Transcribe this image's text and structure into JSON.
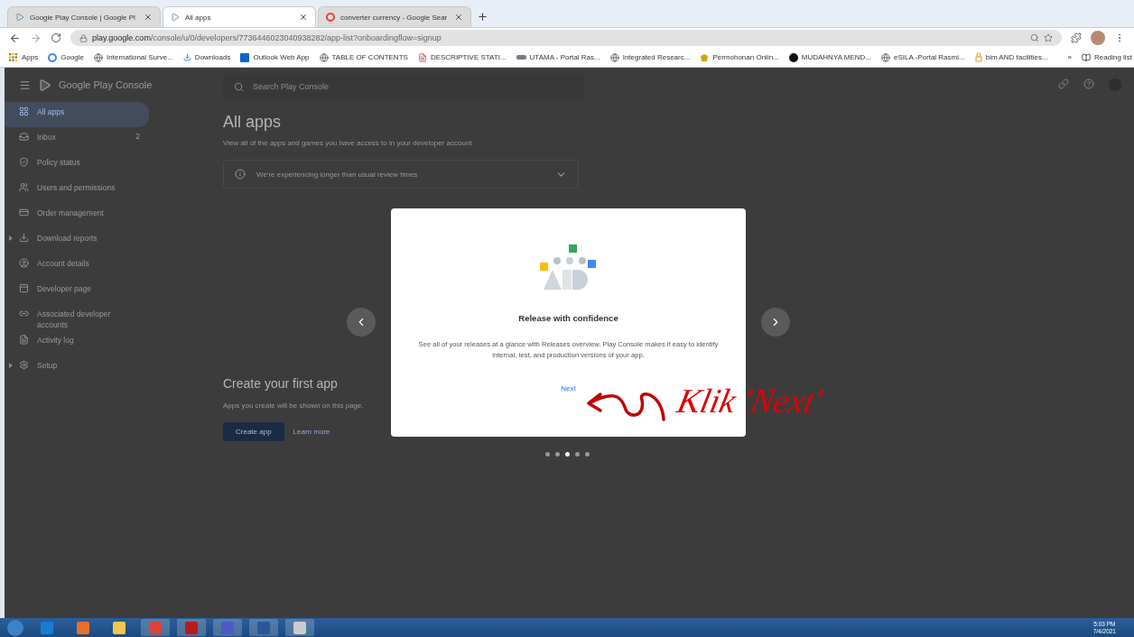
{
  "browser": {
    "tabs": [
      {
        "title": "Google Play Console | Google Pl",
        "selected": false
      },
      {
        "title": "All apps",
        "selected": true
      },
      {
        "title": "converter currency - Google Sear",
        "selected": false
      }
    ],
    "url_host": "play.google.com",
    "url_path": "/console/u/0/developers/7736446023040938282/app-list?onboardingflow=signup",
    "bookmarks": [
      {
        "label": "Apps"
      },
      {
        "label": "Google"
      },
      {
        "label": "International Surve..."
      },
      {
        "label": "Downloads"
      },
      {
        "label": "Outlook Web App"
      },
      {
        "label": "TABLE OF CONTENTS"
      },
      {
        "label": "DESCRIPTIVE STATI..."
      },
      {
        "label": "UTAMA - Portal Ras..."
      },
      {
        "label": "Integrated Researc..."
      },
      {
        "label": "Permohonan Onlin..."
      },
      {
        "label": "MUDAHNYA MEND..."
      },
      {
        "label": "eSILA -Portal Rasmi..."
      },
      {
        "label": "bim AND facilities..."
      }
    ],
    "more": "»",
    "reading_list": "Reading list"
  },
  "console": {
    "brand": "Google Play Console",
    "search": {
      "placeholder": "Search Play Console"
    },
    "nav": [
      {
        "label": "All apps",
        "selected": true,
        "expandable": false
      },
      {
        "label": "Inbox",
        "selected": false,
        "expandable": false,
        "count": "2"
      },
      {
        "label": "Policy status",
        "selected": false,
        "expandable": false
      },
      {
        "label": "Users and permissions",
        "selected": false,
        "expandable": false
      },
      {
        "label": "Order management",
        "selected": false,
        "expandable": false
      },
      {
        "label": "Download reports",
        "selected": false,
        "expandable": true
      },
      {
        "label": "Account details",
        "selected": false,
        "expandable": false
      },
      {
        "label": "Developer page",
        "selected": false,
        "expandable": false
      },
      {
        "label": "Associated developer accounts",
        "selected": false,
        "expandable": false
      },
      {
        "label": "Activity log",
        "selected": false,
        "expandable": false
      },
      {
        "label": "Setup",
        "selected": false,
        "expandable": true
      }
    ],
    "title": "All apps",
    "subtitle": "View all of the apps and games you have access to in your developer account",
    "notice": "We're experiencing longer than usual review times",
    "create_title": "Create your first app",
    "create_text": "Apps you create will be shown on this page. ",
    "create_button": "Create app",
    "learn_more": "Learn more"
  },
  "dialog": {
    "title": "Release with confidence",
    "text": "See all of your releases at a glance with Releases overview. Play Console makes it easy to identify internal, test, and production versions of your app.",
    "button": "Next",
    "pages": [
      {
        "selected": false
      },
      {
        "selected": false
      },
      {
        "selected": true
      },
      {
        "selected": false
      },
      {
        "selected": false
      }
    ]
  },
  "annotation": {
    "text": "Klik 'Next'"
  },
  "taskbar": {
    "time": "5:03 PM",
    "date": "7/4/2021"
  }
}
